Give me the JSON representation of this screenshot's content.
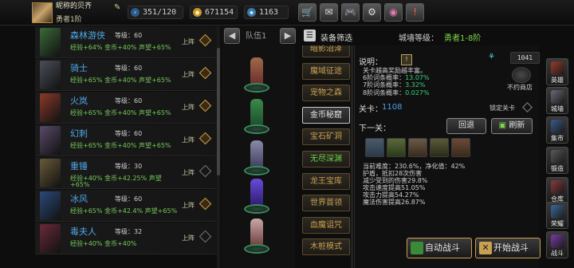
{
  "player": {
    "name": "昵称的贝齐",
    "rank": "勇者1阶"
  },
  "resources": {
    "stamina": "351/120",
    "gold": "671154",
    "gems": "1163"
  },
  "toolbar": {
    "shop": "🛒",
    "mail": "✉",
    "gamepad": "🎮",
    "settings": "⚙",
    "wheel": "◉",
    "bag": "!"
  },
  "heroes": [
    {
      "name": "森林游侠",
      "level_label": "等级：60",
      "stats": "经验+64%   金币+40%   声望+65%",
      "stats2": "",
      "up_label": "上阵",
      "deployed": true,
      "color": "#3b6a3a"
    },
    {
      "name": "骑士",
      "level_label": "等级：60",
      "stats": "经验+65%   金币+40%   声望+65%",
      "stats2": "",
      "up_label": "上阵",
      "deployed": true,
      "color": "#4a4f5a"
    },
    {
      "name": "火岚",
      "level_label": "等级：60",
      "stats": "经验+65%   金币+40%   声望+65%",
      "stats2": "",
      "up_label": "上阵",
      "deployed": true,
      "color": "#8a3a2a"
    },
    {
      "name": "幻刺",
      "level_label": "等级：60",
      "stats": "经验+65%   金币+40%   声望+65%",
      "stats2": "",
      "up_label": "上阵",
      "deployed": true,
      "color": "#5a4a6a"
    },
    {
      "name": "重锤",
      "level_label": "等级：30",
      "stats": "经验+40%   金币+42.25%   声望",
      "stats2": "+65%",
      "up_label": "上阵",
      "deployed": false,
      "color": "#6a5a3a"
    },
    {
      "name": "冰风",
      "level_label": "等级：60",
      "stats": "经验+65%   金币+42.4%   声望+65%",
      "stats2": "",
      "up_label": "上阵",
      "deployed": true,
      "color": "#2a4a7a"
    },
    {
      "name": "毒夫人",
      "level_label": "等级：32",
      "stats": "经验+40%   金币+40%",
      "stats2": "",
      "up_label": "上阵",
      "deployed": false,
      "color": "#6a2a3a"
    }
  ],
  "team": {
    "label": "队伍1",
    "prev": "◀",
    "next": "▶"
  },
  "filter": {
    "label": "装备筛选",
    "city_label": "城墙等级：",
    "city_value": "勇者1-8阶"
  },
  "dungeons": [
    {
      "name": "暗影沼泽",
      "style": ""
    },
    {
      "name": "魔域征途",
      "style": ""
    },
    {
      "name": "宠物之森",
      "style": ""
    },
    {
      "name": "金币秘窟",
      "style": "sel"
    },
    {
      "name": "宝石矿洞",
      "style": ""
    },
    {
      "name": "无尽深渊",
      "style": "green"
    },
    {
      "name": "龙王宝库",
      "style": ""
    },
    {
      "name": "世界首领",
      "style": ""
    },
    {
      "name": "血魔诅咒",
      "style": ""
    },
    {
      "name": "木桩模式",
      "style": ""
    }
  ],
  "details": {
    "info_label": "说明：",
    "info_icon": "!",
    "desc_line1": "关卡越高奖励越丰富。",
    "desc_prob": [
      {
        "label": "6阶词条概率：",
        "value": "13.07%"
      },
      {
        "label": "7阶词条概率：",
        "value": "3.32%"
      },
      {
        "label": "8阶词条概率：",
        "value": "0.027%"
      }
    ],
    "roll_value": "1041",
    "roll_icon": "⚘",
    "shop_label": "不约商店",
    "stage_label": "关卡：",
    "stage_value": "1108",
    "lock_label": "锁定关卡",
    "next_label": "下一关：",
    "back_label": "回退",
    "refresh_label": "刷新",
    "stats": [
      "当前难度：230.6%，净化值：42%",
      "护盾，抵扣28次伤害",
      "减少受到的伤害29.8%",
      "攻击速度提高51.05%",
      "攻击力提高54.27%",
      "魔法伤害提高26.87%"
    ],
    "auto_label": "自动战斗",
    "start_label": "开始战斗"
  },
  "sidebar": [
    {
      "label": "英雄",
      "color": "#9a3a2a"
    },
    {
      "label": "城墙",
      "color": "#6a6a7a"
    },
    {
      "label": "集市",
      "color": "#3a5a8a"
    },
    {
      "label": "锻造",
      "color": "#5a5a5a"
    },
    {
      "label": "仓库",
      "color": "#8a3a3a"
    },
    {
      "label": "荣耀",
      "color": "#3a6a9a"
    },
    {
      "label": "战斗",
      "color": "#7a3aaa"
    }
  ]
}
